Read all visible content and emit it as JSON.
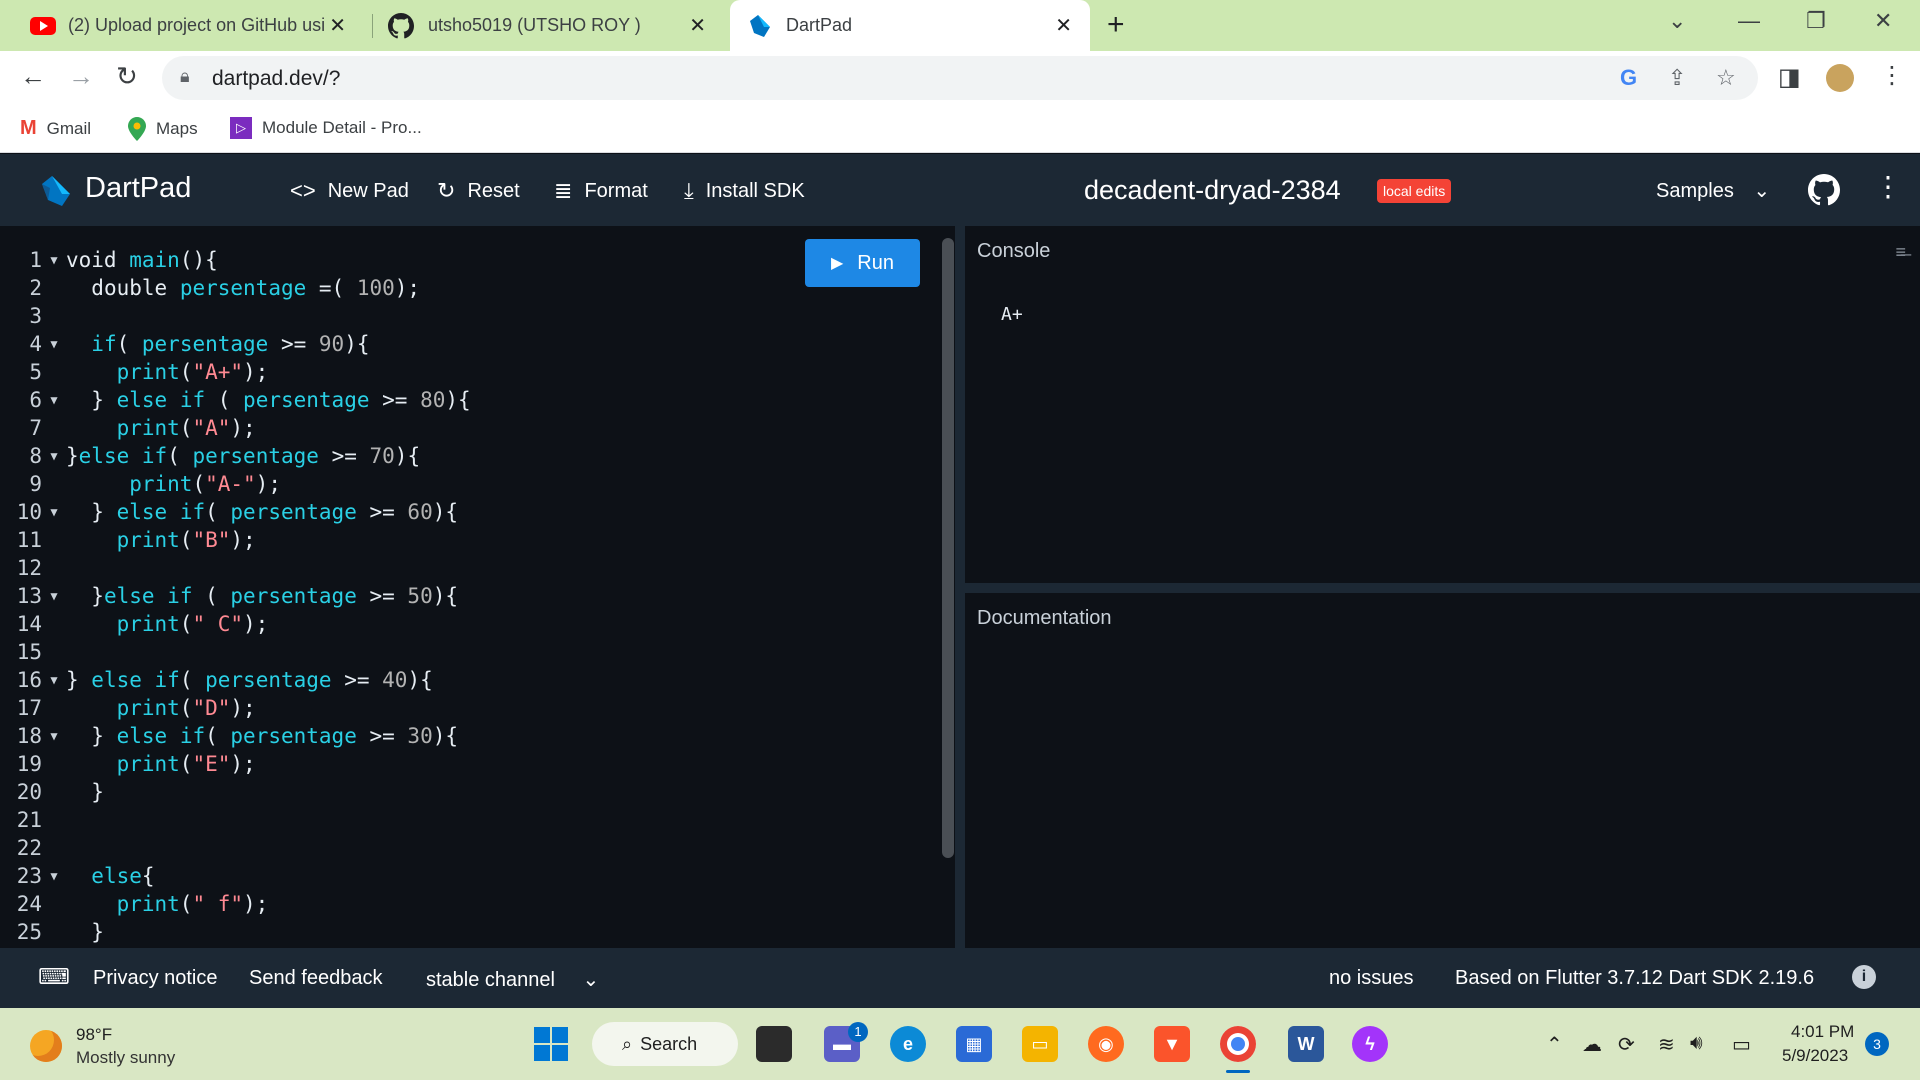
{
  "browser": {
    "tabs": [
      {
        "title": "(2) Upload project on GitHub usi",
        "icon": "youtube-icon"
      },
      {
        "title": "utsho5019 (UTSHO ROY )",
        "icon": "github-icon"
      },
      {
        "title": "DartPad",
        "icon": "dartpad-icon"
      }
    ],
    "url": "dartpad.dev/?",
    "bookmarks": [
      {
        "label": "Gmail"
      },
      {
        "label": "Maps"
      },
      {
        "label": "Module Detail - Pro..."
      }
    ]
  },
  "app": {
    "name": "DartPad",
    "actions": {
      "new_pad": "New Pad",
      "reset": "Reset",
      "format": "Format",
      "install_sdk": "Install SDK"
    },
    "pad_name": "decadent-dryad-2384",
    "badge": "local edits",
    "samples": "Samples",
    "run": "Run"
  },
  "editor": {
    "lines": [
      "void main(){",
      "  double persentage =( 100);",
      "",
      "  if( persentage >= 90){",
      "    print(\"A+\");",
      "  } else if ( persentage >= 80){",
      "    print(\"A\");",
      "}else if( persentage >= 70){",
      "     print(\"A-\");",
      "  } else if( persentage >= 60){",
      "    print(\"B\");",
      "",
      "  }else if ( persentage >= 50){",
      "    print(\" C\");",
      "",
      "} else if( persentage >= 40){",
      "    print(\"D\");",
      "  } else if( persentage >= 30){",
      "    print(\"E\");",
      "  }",
      "",
      "",
      "  else{",
      "    print(\" f\");",
      "  }"
    ],
    "folds": [
      1,
      4,
      6,
      8,
      10,
      13,
      16,
      18,
      23
    ]
  },
  "console": {
    "title": "Console",
    "output": "A+"
  },
  "docs": {
    "title": "Documentation"
  },
  "status": {
    "privacy": "Privacy notice",
    "feedback": "Send feedback",
    "channel": "stable channel",
    "issues": "no issues",
    "version": "Based on Flutter 3.7.12 Dart SDK 2.19.6"
  },
  "taskbar": {
    "temp": "98°F",
    "weather": "Mostly sunny",
    "search": "Search",
    "time": "4:01 PM",
    "date": "5/9/2023",
    "chat_badge": "1",
    "notifications": "3"
  },
  "colors": {
    "keyword": "#2ad0e5",
    "string": "#ff8a93",
    "number": "#b3b3b3",
    "header_bg": "#1c2834",
    "editor_bg": "#0d1117",
    "run_button": "#1e88e5",
    "badge": "#f44336",
    "tabstrip": "#cde8b1"
  }
}
